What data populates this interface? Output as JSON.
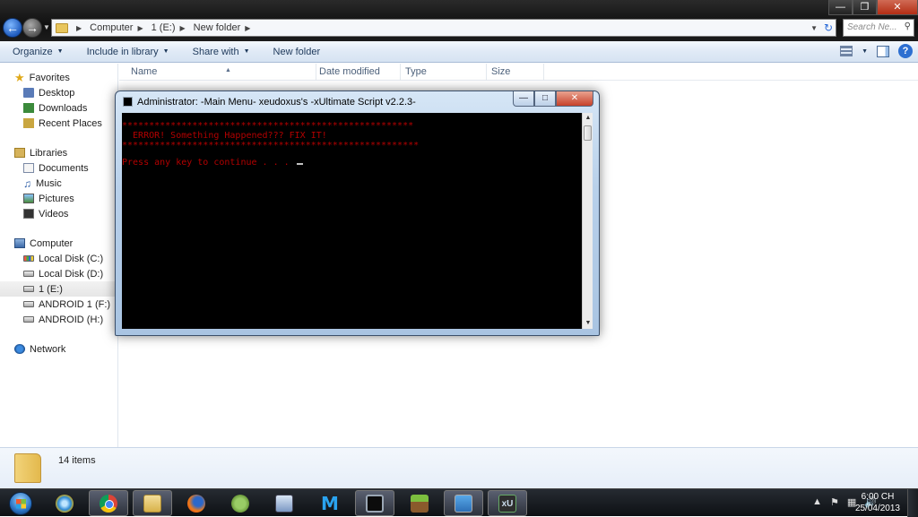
{
  "explorer": {
    "breadcrumb": [
      "Computer",
      "1 (E:)",
      "New folder"
    ],
    "search_placeholder": "Search Ne...",
    "commands": {
      "organize": "Organize",
      "include_in_library": "Include in library",
      "share_with": "Share with",
      "new_folder": "New folder"
    },
    "columns": {
      "name": "Name",
      "date_modified": "Date modified",
      "type": "Type",
      "size": "Size"
    },
    "nav": {
      "favorites": "Favorites",
      "desktop": "Desktop",
      "downloads": "Downloads",
      "recent_places": "Recent Places",
      "libraries": "Libraries",
      "documents": "Documents",
      "music": "Music",
      "pictures": "Pictures",
      "videos": "Videos",
      "computer": "Computer",
      "local_c": "Local Disk (C:)",
      "local_d": "Local Disk (D:)",
      "drive_e": "1 (E:)",
      "android_f": "ANDROID 1 (F:)",
      "android_h": "ANDROID (H:)",
      "network": "Network"
    },
    "status": {
      "items_count": "14 items"
    }
  },
  "console": {
    "title": "Administrator:  -Main Menu- xeudoxus's -xUltimate Script v2.2.3-",
    "line_rule_top": "******************************************************",
    "line_error": "  ERROR! Something Happened??? FIX IT!",
    "line_rule_bottom": "*******************************************************",
    "line_prompt": "Press any key to continue . . . ",
    "text_color": "#b30000"
  },
  "taskbar": {
    "time": "6:00 CH",
    "date": "25/04/2013",
    "pinned_icons": [
      "internet-explorer-icon",
      "chrome-icon",
      "windows-explorer-icon",
      "firefox-icon",
      "android-icon",
      "computer-icon",
      "m-app-icon",
      "terminal-icon",
      "minecraft-icon",
      "remote-desktop-icon",
      "xu-console-icon"
    ]
  }
}
